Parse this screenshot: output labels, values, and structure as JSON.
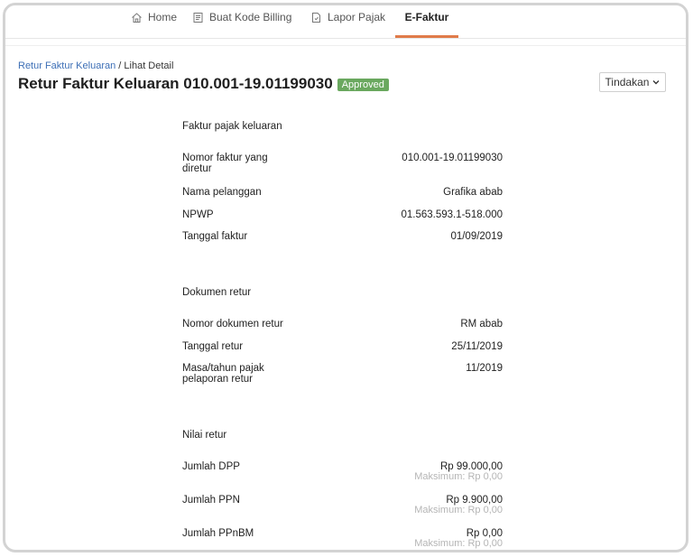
{
  "nav": {
    "home": "Home",
    "billing": "Buat Kode Billing",
    "lapor": "Lapor Pajak",
    "efaktur": "E-Faktur"
  },
  "breadcrumb": {
    "parent": "Retur Faktur Keluaran",
    "separator": " / ",
    "current": "Lihat Detail"
  },
  "header": {
    "title": "Retur Faktur Keluaran 010.001-19.01199030",
    "status": "Approved",
    "action_button": "Tindakan"
  },
  "sections": {
    "faktur": {
      "title": "Faktur pajak keluaran",
      "rows": [
        {
          "label": "Nomor faktur yang diretur",
          "value": "010.001-19.01199030"
        },
        {
          "label": "Nama pelanggan",
          "value": "Grafika abab"
        },
        {
          "label": "NPWP",
          "value": "01.563.593.1-518.000"
        },
        {
          "label": "Tanggal faktur",
          "value": "01/09/2019"
        }
      ]
    },
    "dokumen": {
      "title": "Dokumen retur",
      "rows": [
        {
          "label": "Nomor dokumen retur",
          "value": "RM abab"
        },
        {
          "label": "Tanggal retur",
          "value": "25/11/2019"
        },
        {
          "label": "Masa/tahun pajak pelaporan retur",
          "value": "11/2019"
        }
      ]
    },
    "nilai": {
      "title": "Nilai retur",
      "rows": [
        {
          "label": "Jumlah DPP",
          "value": "Rp 99.000,00",
          "sub": "Maksimum: Rp 0,00"
        },
        {
          "label": "Jumlah PPN",
          "value": "Rp 9.900,00",
          "sub": "Maksimum: Rp 0,00"
        },
        {
          "label": "Jumlah PPnBM",
          "value": "Rp 0,00",
          "sub": "Maksimum: Rp 0,00"
        }
      ]
    }
  },
  "colors": {
    "accent": "#e07b4a",
    "link": "#3d6fb6",
    "approved": "#6aa85f"
  }
}
